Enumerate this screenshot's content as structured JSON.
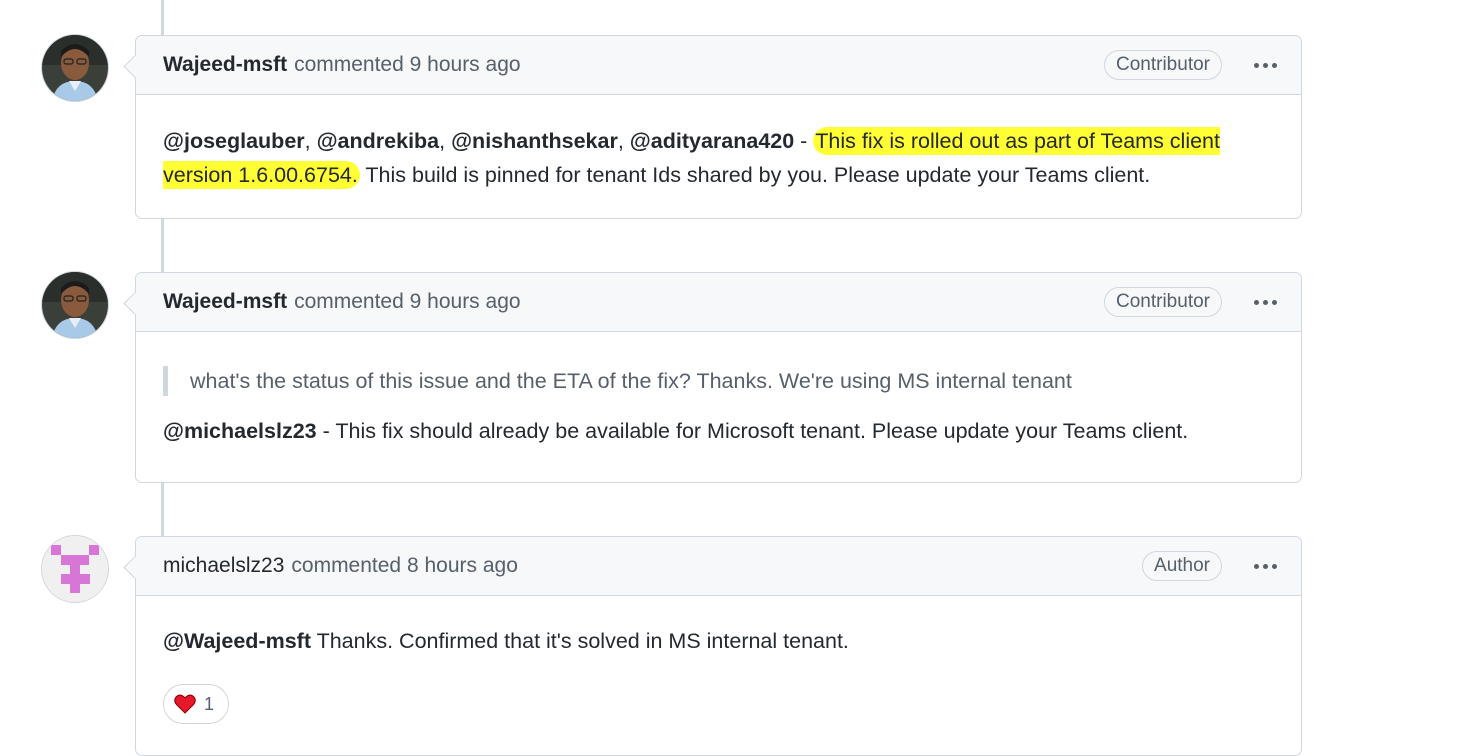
{
  "comments": [
    {
      "author": "Wajeed-msft",
      "action": "commented",
      "time": "9 hours ago",
      "role": "Contributor",
      "body": {
        "mentions": [
          "@joseglauber",
          "@andrekiba",
          "@nishanthsekar",
          "@adityarana420"
        ],
        "sep": ", ",
        "dash": " - ",
        "highlight": "This fix is rolled out as part of Teams client version 1.6.00.6754.",
        "rest": " This build is pinned for tenant Ids shared by you. Please update your Teams client."
      }
    },
    {
      "author": "Wajeed-msft",
      "action": "commented",
      "time": "9 hours ago",
      "role": "Contributor",
      "body": {
        "quote": "what's the status of this issue and the ETA of the fix? Thanks. We're using MS internal tenant",
        "mention": "@michaelslz23",
        "text": " - This fix should already be available for Microsoft tenant. Please update your Teams client."
      }
    },
    {
      "author": "michaelslz23",
      "action": "commented",
      "time": "8 hours ago",
      "role": "Author",
      "body": {
        "mention": "@Wajeed-msft",
        "text": " Thanks. Confirmed that it's solved in MS internal tenant."
      },
      "reaction": {
        "icon": "heart-icon",
        "count": "1"
      }
    }
  ],
  "colors": {
    "highlight": "#ffff33",
    "border": "#d0d7de",
    "header_bg": "#f6f8fa",
    "identicon": "#d776d6"
  }
}
